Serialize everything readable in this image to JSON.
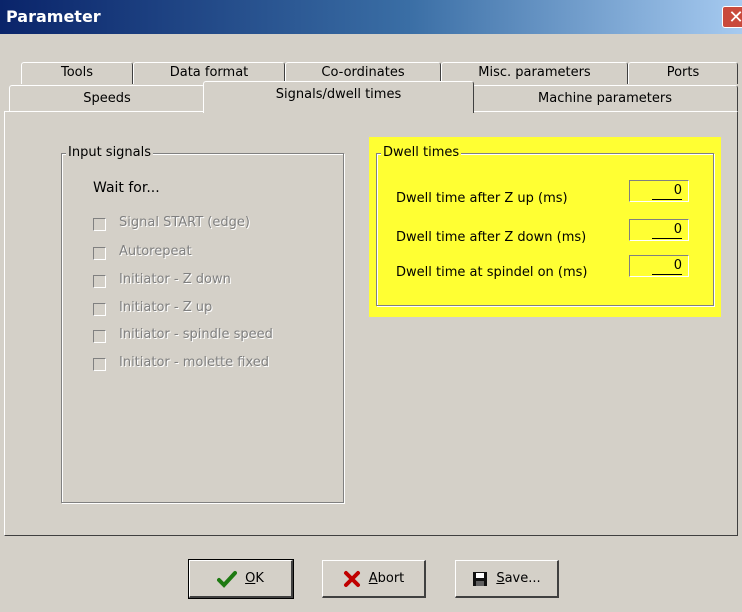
{
  "window": {
    "title": "Parameter",
    "close_symbol": "✕"
  },
  "tabs_row1": [
    "Tools",
    "Data format",
    "Co-ordinates",
    "Misc. parameters",
    "Ports"
  ],
  "tabs_row2": [
    "Speeds",
    "Signals/dwell times",
    "Machine parameters"
  ],
  "active_tab": "Signals/dwell times",
  "input_signals": {
    "title": "Input signals",
    "wait_for": "Wait for...",
    "checkboxes": [
      "Signal START (edge)",
      "Autorepeat",
      "Initiator - Z down",
      "Initiator - Z up",
      "Initiator - spindle speed",
      "Initiator - molette fixed"
    ]
  },
  "dwell_times": {
    "title": "Dwell times",
    "highlight_color": "#ffff33",
    "rows": [
      {
        "label": "Dwell time after Z up (ms)",
        "value": "0"
      },
      {
        "label": "Dwell time after Z down (ms)",
        "value": "0"
      },
      {
        "label": "Dwell time at spindel on (ms)",
        "value": "0"
      }
    ]
  },
  "buttons": {
    "ok": {
      "mnemonic": "O",
      "rest": "K",
      "icon": "check-icon"
    },
    "abort": {
      "mnemonic": "A",
      "rest": "bort",
      "icon": "x-icon"
    },
    "save": {
      "mnemonic": "S",
      "rest": "ave...",
      "icon": "floppy-disk-icon"
    }
  }
}
